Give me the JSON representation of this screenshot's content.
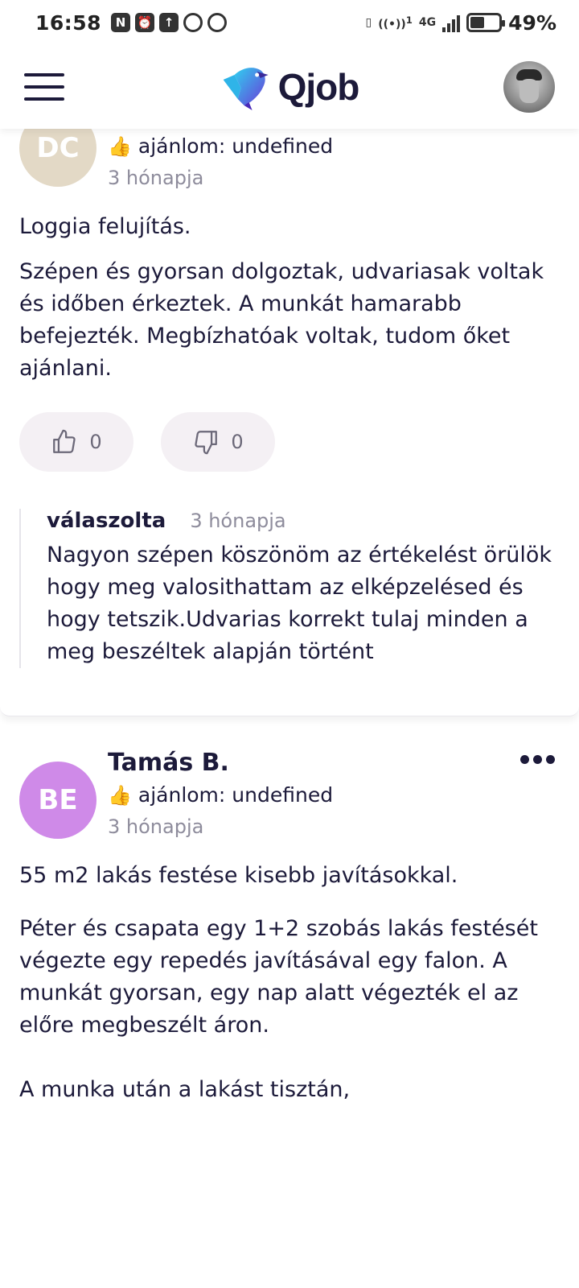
{
  "status_bar": {
    "time": "16:58",
    "left_icons": [
      "N",
      "alarm-icon",
      "upload-icon",
      "chrome-icon",
      "chrome-icon"
    ],
    "network_label": "4G",
    "hotspot_sup": "1",
    "battery_level": 0.49,
    "battery_percent": "49%"
  },
  "header": {
    "logo_text": "Qjob",
    "brand_colors": [
      "#2fb4e8",
      "#6a3bd8"
    ]
  },
  "reviews": [
    {
      "initials": "DC",
      "avatar_color": "#e3d9c6",
      "recommend_text": "ajánlom: undefined",
      "time_ago": "3 hónapja",
      "title": "Loggia felujítás.",
      "body": "Szépen és gyorsan dolgoztak, udvariasak voltak és időben érkeztek. A munkát hamarabb befejezték. Megbízhatóak voltak, tudom őket ajánlani.",
      "likes": "0",
      "dislikes": "0",
      "reply": {
        "author": "válaszolta",
        "time_ago": "3 hónapja",
        "text": "Nagyon szépen köszönöm az értékelést örülök hogy meg valosithattam az elképzelésed és hogy tetszik.Udvarias korrekt tulaj minden a meg beszéltek alapján történt"
      }
    },
    {
      "initials": "BE",
      "avatar_color": "#cf8ae8",
      "name": "Tamás B.",
      "recommend_text": "ajánlom: undefined",
      "time_ago": "3 hónapja",
      "title": "55 m2 lakás festése kisebb javításokkal.",
      "body": "Péter és csapata egy 1+2 szobás lakás festését végezte egy repedés javításával egy falon. A munkát gyorsan, egy nap alatt végezték el az előre megbeszélt áron.",
      "body_continued": "A munka után a lakást tisztán,"
    }
  ]
}
